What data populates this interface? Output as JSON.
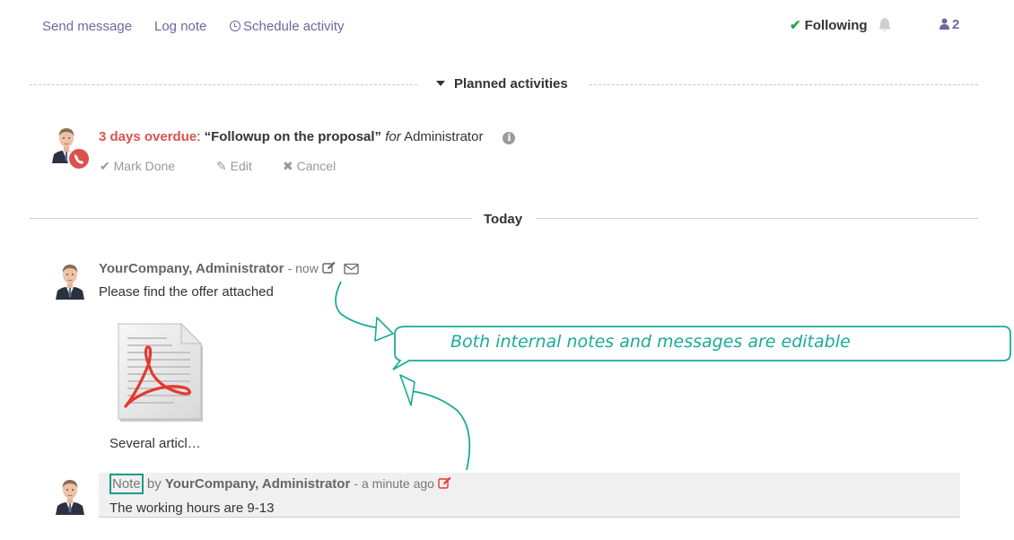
{
  "topbar": {
    "send_message": "Send message",
    "log_note": "Log note",
    "schedule_activity": "Schedule activity",
    "following": "Following",
    "followers_count": "2"
  },
  "planned": {
    "title": "Planned activities",
    "activity": {
      "overdue": "3 days overdue",
      "summary": "“Followup on the proposal”",
      "for_label": "for",
      "assignee": "Administrator",
      "mark_done": "Mark Done",
      "edit": "Edit",
      "cancel": "Cancel"
    }
  },
  "today_label": "Today",
  "message": {
    "author": "YourCompany, Administrator",
    "date": "- now",
    "body": "Please find the offer attached",
    "attachment_name": "Several articl…"
  },
  "note": {
    "label": "Note",
    "by": "by",
    "author": "YourCompany, Administrator",
    "date": "- a minute ago",
    "body": "The working hours are 9-13"
  },
  "callout": {
    "text": "Both internal notes and messages are editable"
  },
  "colors": {
    "link": "#6b6a9e",
    "overdue": "#d9534f",
    "callout": "#1aab96",
    "following_check": "#28a745"
  }
}
